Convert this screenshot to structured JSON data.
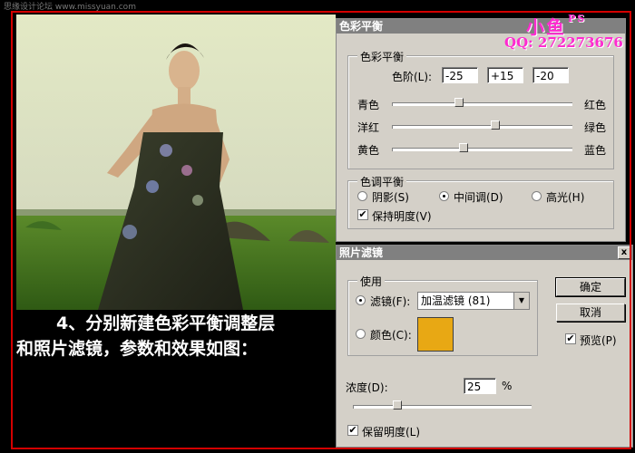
{
  "watermark_top": "思缘设计论坛 www.missyuan.com",
  "brand": {
    "name": "小鱼",
    "suffix": "PS",
    "qq": "QQ: 272273676"
  },
  "caption": {
    "line1": "4、分别新建色彩平衡调整层",
    "line2": "和照片滤镜，参数和效果如图："
  },
  "color_balance": {
    "title": "色彩平衡",
    "group_title": "色彩平衡",
    "levels_label": "色阶(L):",
    "levels": [
      "-25",
      "+15",
      "-20"
    ],
    "sliders": [
      {
        "left": "青色",
        "right": "红色",
        "value": -25
      },
      {
        "left": "洋红",
        "right": "绿色",
        "value": 15
      },
      {
        "left": "黄色",
        "right": "蓝色",
        "value": -20
      }
    ],
    "tone_group_title": "色调平衡",
    "tones": [
      {
        "label": "阴影(S)",
        "selected": false
      },
      {
        "label": "中间调(D)",
        "selected": true
      },
      {
        "label": "高光(H)",
        "selected": false
      }
    ],
    "preserve_luminosity": "保持明度(V)",
    "preserve_checked": true
  },
  "photo_filter": {
    "title": "照片滤镜",
    "close": "x",
    "use_group_title": "使用",
    "filter_radio": "滤镜(F):",
    "filter_value": "加温滤镜 (81)",
    "color_radio": "颜色(C):",
    "color_hex": "#e8a814",
    "ok_label": "确定",
    "cancel_label": "取消",
    "preview_label": "预览(P)",
    "preview_checked": true,
    "density_label": "浓度(D):",
    "density_value": "25",
    "density_unit": "%",
    "preserve_label": "保留明度(L)",
    "preserve_checked": true
  }
}
